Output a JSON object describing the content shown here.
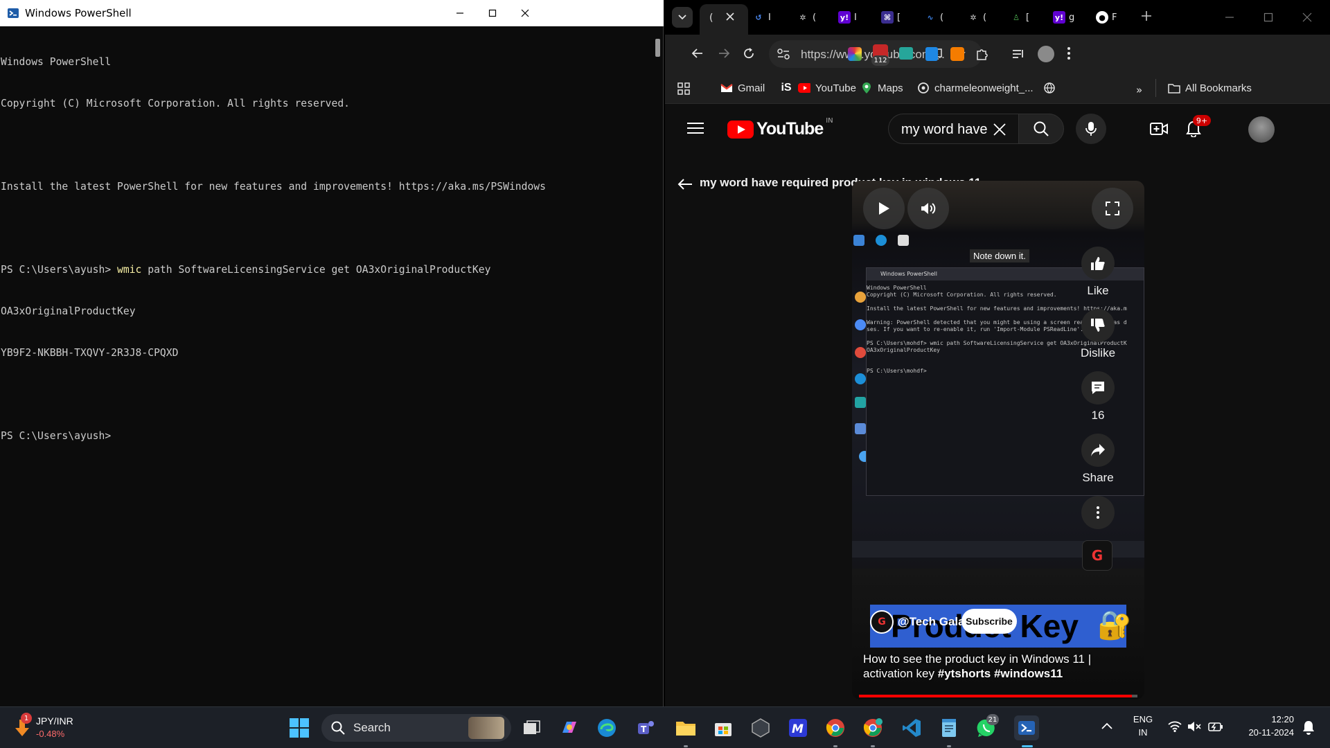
{
  "powershell": {
    "title": "Windows PowerShell",
    "lines": [
      {
        "text": "Windows PowerShell"
      },
      {
        "text": "Copyright (C) Microsoft Corporation. All rights reserved."
      },
      {
        "text": ""
      },
      {
        "text": "Install the latest PowerShell for new features and improvements! https://aka.ms/PSWindows"
      },
      {
        "text": ""
      },
      {
        "prompt": "PS C:\\Users\\ayush> ",
        "cmd": "wmic",
        "args": " path SoftwareLicensingService get OA3xOriginalProductKey"
      },
      {
        "text": "OA3xOriginalProductKey"
      },
      {
        "text": "YB9F2-NKBBH-TXQVY-2R3J8-CPQXD"
      },
      {
        "text": ""
      },
      {
        "text": "PS C:\\Users\\ayush>"
      }
    ]
  },
  "chrome": {
    "url": "https://www.youtube.com/...",
    "extension_badge": "112",
    "tabs": [
      {
        "label": "(",
        "icon": "youtube-icon",
        "color": "#ff0000"
      },
      {
        "label": "I",
        "icon": "history-icon",
        "color": "#4c8bf5"
      },
      {
        "label": "(",
        "icon": "chatgpt-icon",
        "color": "#cccccc"
      },
      {
        "label": "I",
        "icon": "yahoo-icon",
        "color": "#6001d2"
      },
      {
        "label": "[",
        "icon": "app-icon",
        "color": "#5c3ee8"
      },
      {
        "label": "(",
        "icon": "wave-icon",
        "color": "#3b7ddd"
      },
      {
        "label": "(",
        "icon": "chatgpt-icon",
        "color": "#cccccc"
      },
      {
        "label": "[",
        "icon": "doc-icon",
        "color": "#2e7d32"
      },
      {
        "label": "g",
        "icon": "yahoo-icon",
        "color": "#6001d2"
      },
      {
        "label": "F",
        "icon": "github-icon",
        "color": "#ffffff"
      }
    ],
    "bookmarks": [
      {
        "label": "Gmail",
        "icon": "gmail-icon"
      },
      {
        "label": "",
        "icon": "is-icon"
      },
      {
        "label": "YouTube",
        "icon": "youtube-icon"
      },
      {
        "label": "Maps",
        "icon": "maps-icon"
      },
      {
        "label": "charmeleonweight_...",
        "icon": "pokemon-icon"
      },
      {
        "label": "",
        "icon": "globe-icon"
      }
    ],
    "all_bookmarks": "All Bookmarks"
  },
  "youtube": {
    "country": "IN",
    "search_query": "my word have required product key in windows 11",
    "notification_count": "9+",
    "short_title": "my word have required product key in windows 11",
    "video": {
      "overlay_note": "Note down it.",
      "inner_ps_title": "Windows PowerShell",
      "inner_ps_lines": [
        "Windows PowerShell",
        "Copyright (C) Microsoft Corporation. All rights reserved.",
        "",
        "Install the latest PowerShell for new features and improvements! https://aka.m",
        "",
        "Warning: PowerShell detected that you might be using a screen reader and has d",
        "ses. If you want to re-enable it, run 'Import-Module PSReadLine'.",
        "",
        "PS C:\\Users\\mohdf> wmic path SoftwareLicensingService get OA3xOriginalProductK",
        "OA3xOriginalProductKey",
        "",
        "",
        "PS C:\\Users\\mohdf>"
      ],
      "banner_text": "Product Key",
      "channel": "@Tech Galaxy",
      "subscribe": "Subscribe",
      "description_plain": "How to see the product key in Windows 11 | activation key ",
      "description_tags": "#ytshorts #windows11",
      "progress": 0.98
    },
    "actions": {
      "like": "Like",
      "dislike": "Dislike",
      "comments": "16",
      "share": "Share"
    }
  },
  "taskbar": {
    "widget_badge": "1",
    "widget_title": "JPY/INR",
    "widget_value": "-0.48%",
    "search": "Search",
    "whatsapp_badge": "21",
    "lang": "ENG",
    "region": "IN",
    "time": "12:20",
    "date": "20-11-2024"
  }
}
